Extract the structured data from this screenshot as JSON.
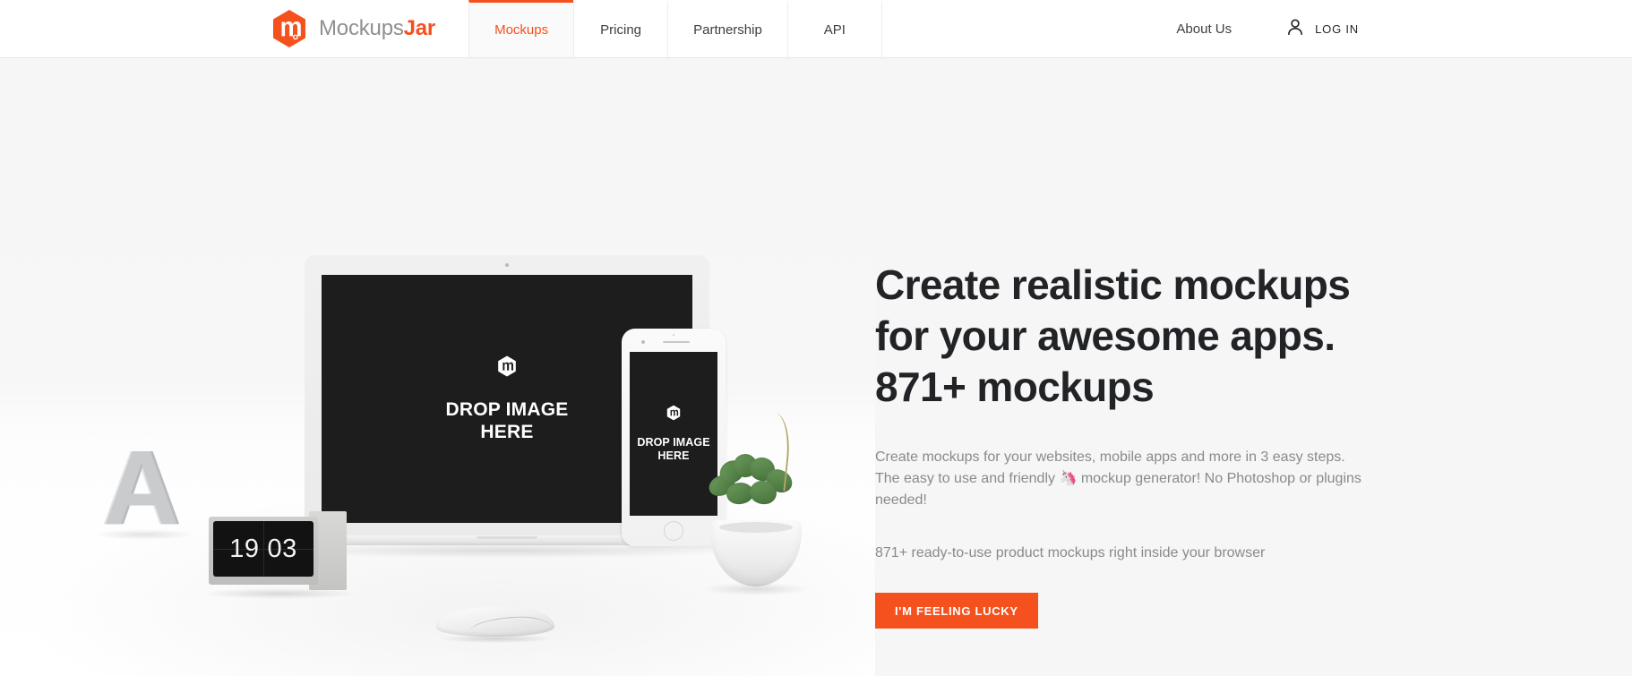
{
  "header": {
    "brand": {
      "logo_icon": "hexagon-m-logo-icon",
      "name_primary": "Mockups",
      "name_accent": "Jar"
    },
    "nav": [
      {
        "label": "Mockups",
        "active": true
      },
      {
        "label": "Pricing",
        "active": false
      },
      {
        "label": "Partnership",
        "active": false
      },
      {
        "label": "API",
        "active": false
      }
    ],
    "about_label": "About Us",
    "login_label": "LOG IN",
    "login_icon": "user-icon"
  },
  "hero": {
    "title": "Create realistic mockups for your awesome apps. 871+ mockups",
    "description_part1": "Create mockups for your websites, mobile apps and more in 3 easy steps. The easy to use and friendly ",
    "description_emoji": "🦄",
    "description_part2": " mockup generator! No Photoshop or plugins needed!",
    "subtext": "871+ ready-to-use product mockups right inside your browser",
    "cta_label": "I'M FEELING LUCKY"
  },
  "scene": {
    "laptop": {
      "drop_text_line1": "DROP IMAGE",
      "drop_text_line2": "HERE",
      "logo_icon": "hexagon-m-logo-icon"
    },
    "phone": {
      "drop_text_line1": "DROP IMAGE",
      "drop_text_line2": "HERE",
      "logo_icon": "hexagon-m-logo-icon"
    },
    "clock": {
      "hours": "19",
      "minutes": "03"
    },
    "letter_prop": "A"
  },
  "colors": {
    "accent": "#f4511e",
    "hero_background": "#f6f6f6",
    "header_background": "#ffffff",
    "heading_text": "#212326",
    "body_text": "#8a8a8a",
    "screen_background": "#1d1d1d"
  }
}
